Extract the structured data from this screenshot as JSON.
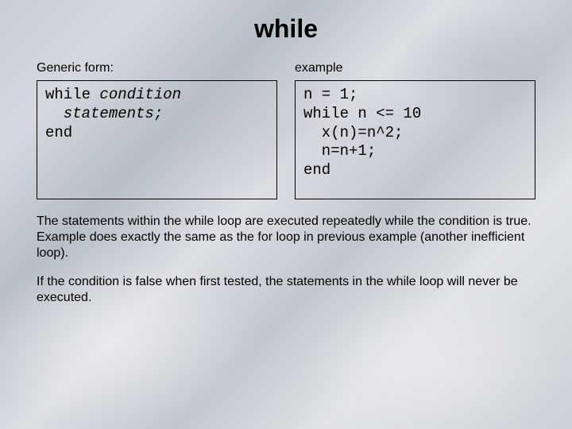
{
  "title": "while",
  "left": {
    "label": "Generic form:",
    "code": {
      "l1a": "while ",
      "l1b": "condition",
      "l2": "  statements;",
      "l3": "end"
    }
  },
  "right": {
    "label": "example",
    "code": {
      "l1": "n = 1;",
      "l2": "while n <= 10",
      "l3": "  x(n)=n^2;",
      "l4": "  n=n+1;",
      "l5": "end"
    }
  },
  "para1": "The statements within the while loop are executed repeatedly while the condition is true. Example does exactly the same as the for loop in previous example (another inefficient loop).",
  "para2": "If the condition is false when first tested, the statements in the while loop will never be executed."
}
